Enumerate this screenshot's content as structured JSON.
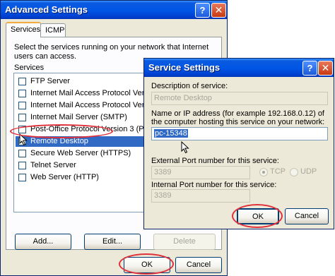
{
  "advanced": {
    "title": "Advanced Settings",
    "help_glyph": "?",
    "close_glyph": "✕",
    "tabs": [
      {
        "label": "Services"
      },
      {
        "label": "ICMP"
      }
    ],
    "intro": "Select the services running on your network that Internet users can access.",
    "services_label": "Services",
    "services": [
      {
        "label": "FTP Server",
        "checked": false
      },
      {
        "label": "Internet Mail Access Protocol Version 3",
        "checked": false
      },
      {
        "label": "Internet Mail Access Protocol Version 4",
        "checked": false
      },
      {
        "label": "Internet Mail Server (SMTP)",
        "checked": false
      },
      {
        "label": "Post-Office Protocol Version 3 (POP3)",
        "checked": false
      },
      {
        "label": "Remote Desktop",
        "checked": true,
        "selected": true
      },
      {
        "label": "Secure Web Server (HTTPS)",
        "checked": false
      },
      {
        "label": "Telnet Server",
        "checked": false
      },
      {
        "label": "Web Server (HTTP)",
        "checked": false
      }
    ],
    "check_glyph": "✓",
    "buttons": {
      "add": "Add...",
      "edit": "Edit...",
      "delete": "Delete",
      "ok": "OK",
      "cancel": "Cancel"
    }
  },
  "service": {
    "title": "Service Settings",
    "help_glyph": "?",
    "close_glyph": "✕",
    "description_label": "Description of service:",
    "description_value": "Remote Desktop",
    "host_label": "Name or IP address (for example 192.168.0.12) of the computer hosting this service on your network:",
    "host_value": "pc-15348",
    "external_port_label": "External Port number for this service:",
    "external_port_value": "3389",
    "internal_port_label": "Internal Port number for this service:",
    "internal_port_value": "3389",
    "tcp_label": "TCP",
    "udp_label": "UDP",
    "protocol_selected": "TCP",
    "buttons": {
      "ok": "OK",
      "cancel": "Cancel"
    }
  },
  "colors": {
    "titlebar": "#0055e5",
    "selection": "#316ac5",
    "highlight_circle": "#e0303a",
    "dialog_bg": "#ece9d8"
  }
}
